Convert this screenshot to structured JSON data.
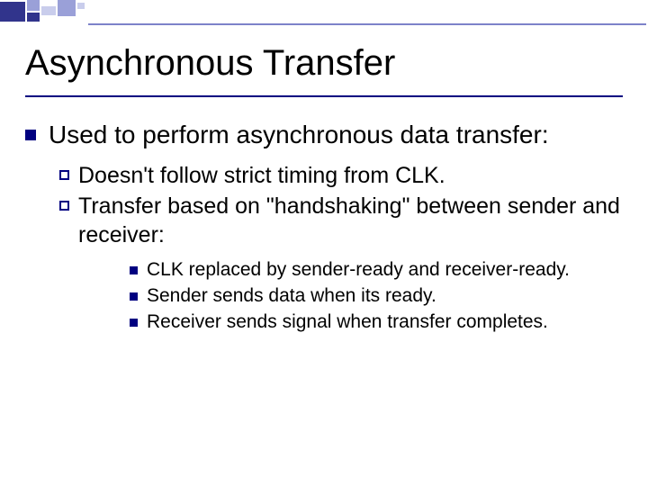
{
  "title": "Asynchronous Transfer",
  "lvl1": {
    "text": "Used to perform asynchronous data transfer:"
  },
  "lvl2": [
    {
      "text": "Doesn't follow strict timing from CLK."
    },
    {
      "text": "Transfer based on \"handshaking\" between sender and receiver:"
    }
  ],
  "lvl3": [
    {
      "text": "CLK replaced by sender-ready and receiver-ready."
    },
    {
      "text": "Sender sends data when its ready."
    },
    {
      "text": "Receiver sends signal when transfer completes."
    }
  ],
  "colors": {
    "accent": "#000080",
    "decor_dark": "#31348c",
    "decor_mid": "#9aa0d8",
    "decor_light": "#c9cdec"
  }
}
